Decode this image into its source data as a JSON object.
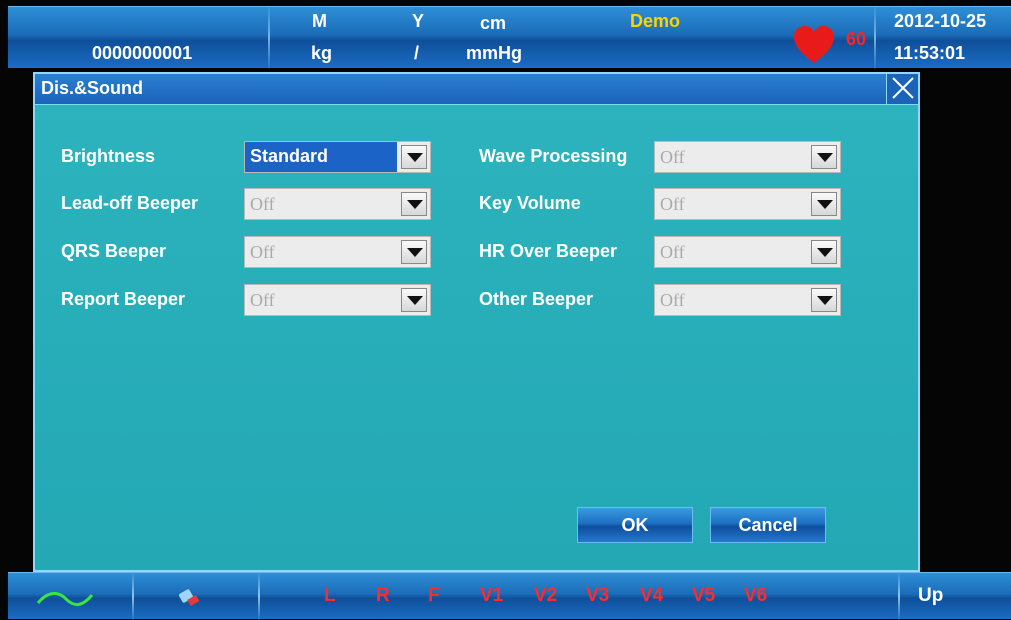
{
  "status_bar": {
    "patient_id": "0000000001",
    "gender": "M",
    "weight_unit": "kg",
    "age_unit": "Y",
    "separator": "/",
    "height_unit": "cm",
    "pressure_unit": "mmHg",
    "mode": "Demo",
    "heart_rate": "60",
    "date": "2012-10-25",
    "time": "11:53:01",
    "colors": {
      "mode": "#ffd200",
      "heart": "#e81a1a"
    }
  },
  "dialog": {
    "title": "Dis.&Sound",
    "close_icon": "close-icon",
    "left_fields": [
      {
        "label": "Brightness",
        "value": "Standard"
      },
      {
        "label": "Lead-off Beeper",
        "value": "Off"
      },
      {
        "label": "QRS Beeper",
        "value": "Off"
      },
      {
        "label": "Report Beeper",
        "value": "Off"
      }
    ],
    "right_fields": [
      {
        "label": "Wave Processing",
        "value": "Off"
      },
      {
        "label": "Key Volume",
        "value": "Off"
      },
      {
        "label": "HR Over Beeper",
        "value": "Off"
      },
      {
        "label": "Other Beeper",
        "value": "Off"
      }
    ],
    "ok_label": "OK",
    "cancel_label": "Cancel"
  },
  "bottom_bar": {
    "waveform_icon": "waveform-icon",
    "electrode_icon": "electrode-icon",
    "leads": [
      "L",
      "R",
      "F",
      "V1",
      "V2",
      "V3",
      "V4",
      "V5",
      "V6"
    ],
    "up_label": "Up"
  }
}
